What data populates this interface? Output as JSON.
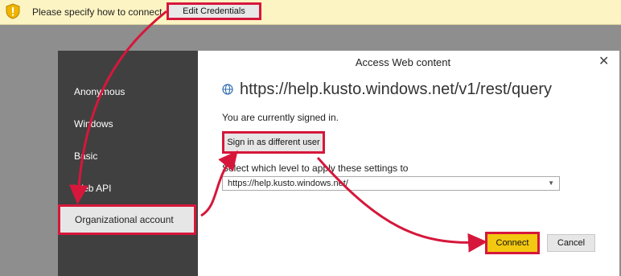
{
  "warning_bar": {
    "message": "Please specify how to connect.",
    "edit_button": "Edit Credentials"
  },
  "dialog": {
    "title": "Access Web content",
    "url": "https://help.kusto.windows.net/v1/rest/query",
    "signed_in_text": "You are currently signed in.",
    "sign_in_button": "Sign in as different user",
    "level_label": "Select which level to apply these settings to",
    "level_value": "https://help.kusto.windows.net/",
    "connect_button": "Connect",
    "cancel_button": "Cancel"
  },
  "auth_methods": {
    "items": [
      "Anonymous",
      "Windows",
      "Basic",
      "Web API"
    ],
    "selected": "Organizational account"
  },
  "colors": {
    "highlight": "#d6173b",
    "connect": "#f2c811",
    "panel": "#404040"
  }
}
